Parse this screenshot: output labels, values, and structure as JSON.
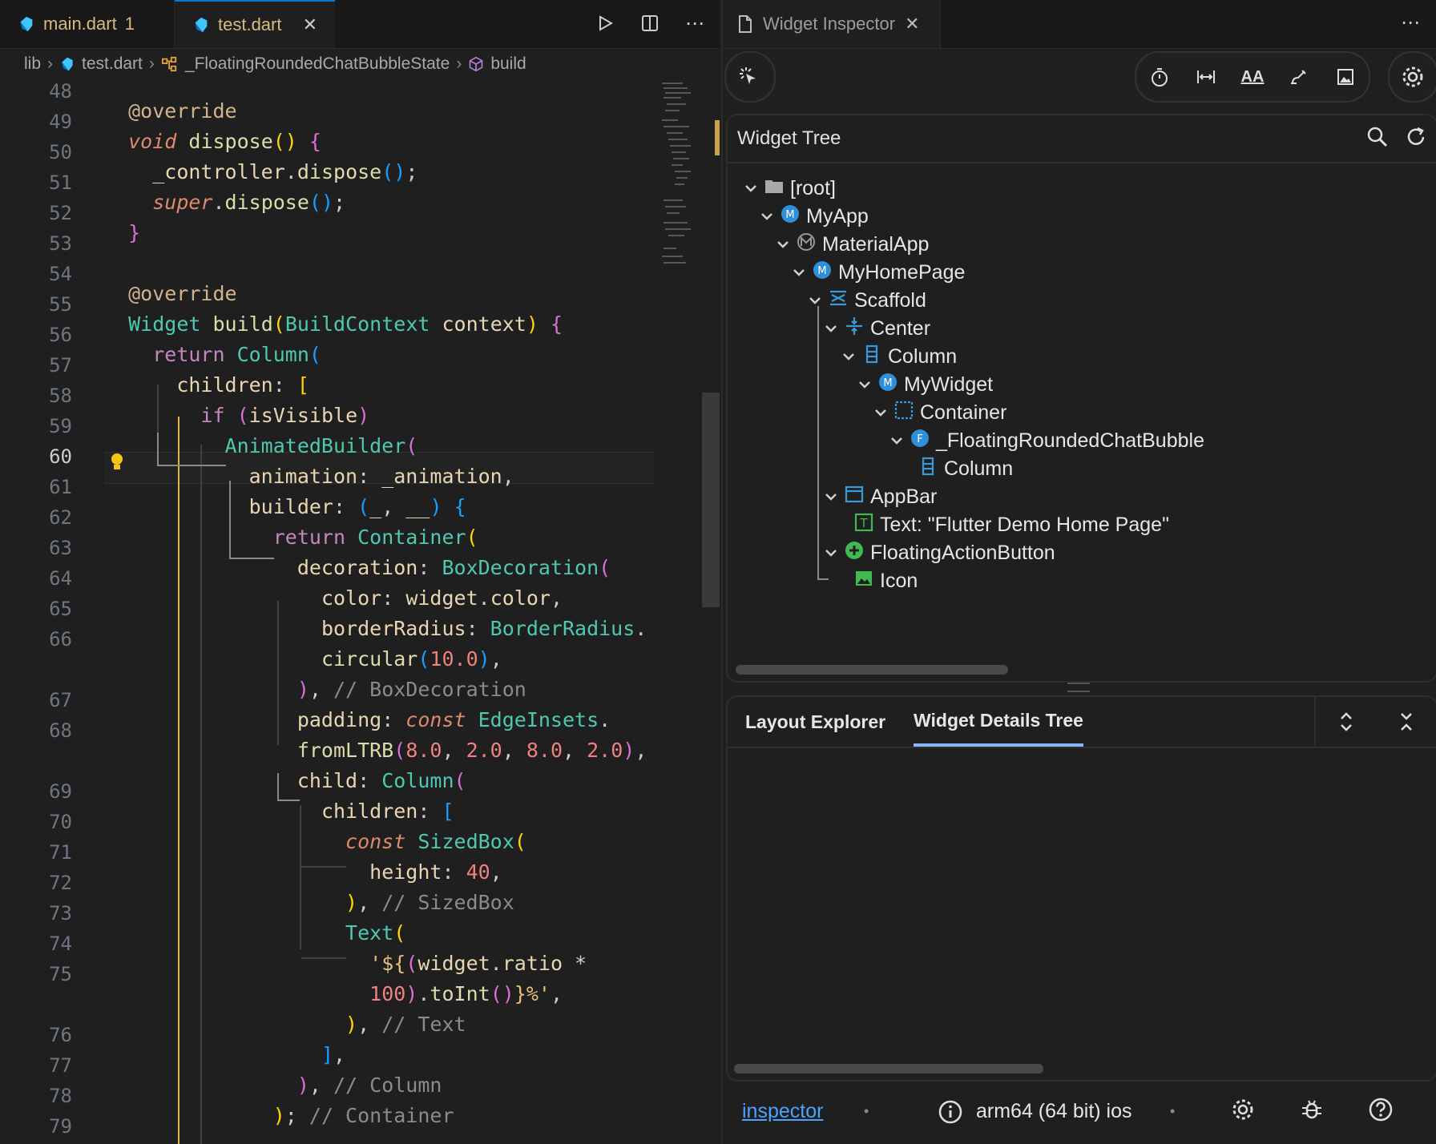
{
  "editor": {
    "tabs": [
      {
        "label": "main.dart",
        "badge": "1"
      },
      {
        "label": "test.dart"
      }
    ],
    "breadcrumb": [
      "lib",
      "test.dart",
      "_FloatingRoundedChatBubbleState",
      "build"
    ],
    "line_numbers": [
      "48",
      "49",
      "50",
      "51",
      "52",
      "53",
      "54",
      "55",
      "56",
      "57",
      "58",
      "59",
      "60",
      "61",
      "62",
      "63",
      "64",
      "65",
      "66",
      "",
      "67",
      "68",
      "",
      "69",
      "70",
      "71",
      "72",
      "73",
      "74",
      "75",
      "",
      "76",
      "77",
      "78",
      "79"
    ],
    "current_line": "60"
  },
  "inspector": {
    "tab_title": "Widget Inspector",
    "widget_tree": {
      "title": "Widget Tree",
      "nodes": [
        "[root]",
        "MyApp",
        "MaterialApp",
        "MyHomePage",
        "Scaffold",
        "Center",
        "Column",
        "MyWidget",
        "Container",
        "_FloatingRoundedChatBubble",
        "Column",
        "AppBar",
        "Text: \"Flutter Demo Home Page\"",
        "FloatingActionButton",
        "Icon"
      ]
    },
    "details": {
      "tabs": [
        "Layout Explorer",
        "Widget Details Tree"
      ],
      "selected_tab": "Widget Details Tree"
    },
    "status": {
      "link": "inspector",
      "device": "arm64 (64 bit) ios"
    }
  },
  "colors": {
    "accent_blue": "#0078d4",
    "tab_modified": "#d7ba7d",
    "indent_guide_gold": "#d7ba45",
    "link": "#4aa3ff"
  }
}
